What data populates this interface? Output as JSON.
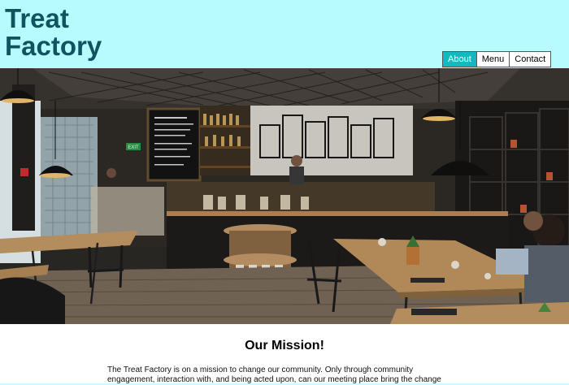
{
  "header": {
    "brand_line1": "Treat",
    "brand_line2": "Factory",
    "nav": [
      {
        "label": "About",
        "active": true
      },
      {
        "label": "Menu",
        "active": false
      },
      {
        "label": "Contact",
        "active": false
      }
    ]
  },
  "hero": {
    "exit_sign": "EXIT"
  },
  "mission": {
    "title": "Our Mission!",
    "text": "The Treat Factory is on a mission to change our community. Only through community engagement, interaction with, and being acted upon, can our meeting place bring the change"
  },
  "colors": {
    "header_bg": "#b8fbff",
    "brand": "#0e5560",
    "nav_active": "#13b8c0",
    "page_bg": "#ccfbff"
  }
}
